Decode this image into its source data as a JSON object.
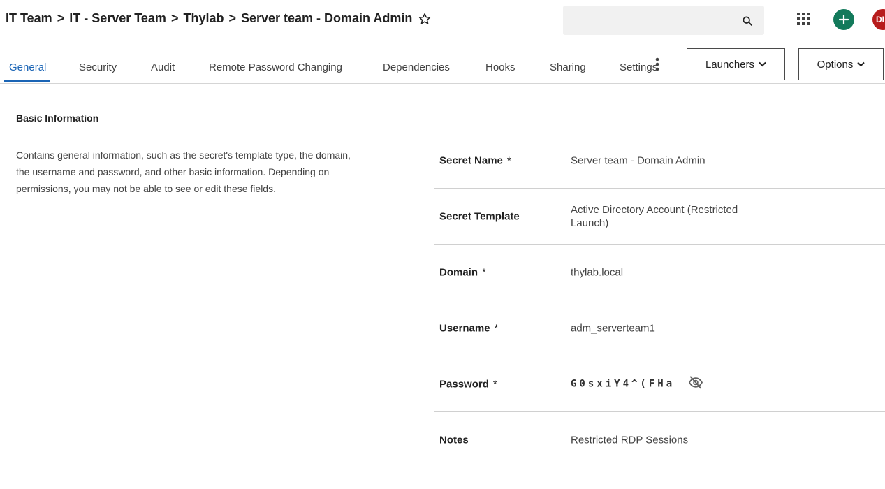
{
  "breadcrumb": [
    "IT Team",
    "IT - Server Team",
    "Thylab",
    "Server team - Domain Admin"
  ],
  "breadcrumb_separator": ">",
  "search": {
    "placeholder": "",
    "value": ""
  },
  "header": {
    "avatar_initials": "DI"
  },
  "tabs": [
    {
      "label": "General",
      "active": true
    },
    {
      "label": "Security"
    },
    {
      "label": "Audit"
    },
    {
      "label": "Remote Password Changing"
    },
    {
      "label": "Dependencies"
    },
    {
      "label": "Hooks"
    },
    {
      "label": "Sharing"
    },
    {
      "label": "Settings"
    }
  ],
  "actions": {
    "launchers_label": "Launchers",
    "options_label": "Options"
  },
  "basic_info": {
    "title": "Basic Information",
    "description": "Contains general information, such as the secret's template type, the domain, the username and password, and other basic information. Depending on permissions, you may not be able to see or edit these fields."
  },
  "fields": [
    {
      "label": "Secret Name",
      "required": "*",
      "value": "Server team - Domain Admin"
    },
    {
      "label": "Secret Template",
      "value": "Active Directory Account (Restricted Launch)"
    },
    {
      "label": "Domain",
      "required": "*",
      "value": "thylab.local"
    },
    {
      "label": "Username",
      "required": "*",
      "value": "adm_serverteam1"
    },
    {
      "label": "Password",
      "required": "*",
      "value": "G0sxiY4^(FHa"
    },
    {
      "label": "Notes",
      "value": "Restricted RDP Sessions"
    }
  ],
  "colors": {
    "accent": "#1a64b5",
    "add_button": "#137a5b",
    "avatar": "#b71c1c",
    "search_bg": "#f1f1f1"
  },
  "icons": [
    "star-outline-icon",
    "search-icon",
    "apps-grid-icon",
    "plus-icon",
    "more-vert-icon",
    "chevron-down-icon",
    "eye-off-icon"
  ]
}
